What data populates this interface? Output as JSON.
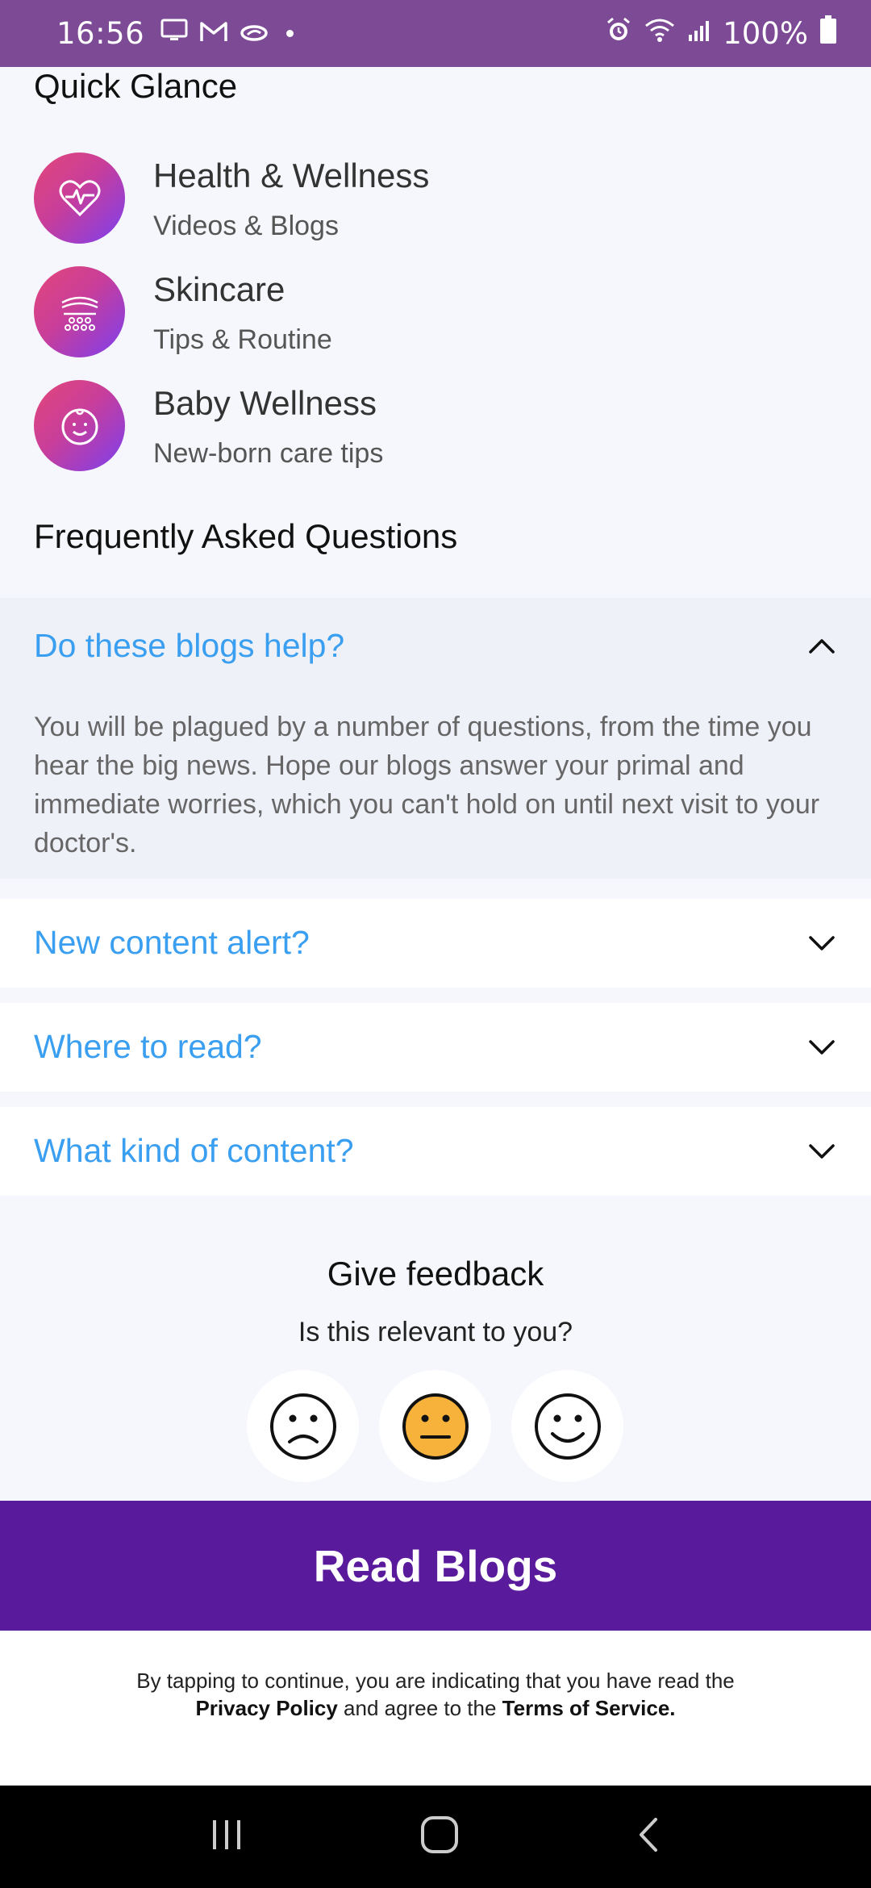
{
  "status_bar": {
    "time": "16:56",
    "battery": "100%",
    "icons_left": [
      "monitor-icon",
      "gmail-icon",
      "link-icon",
      "dot"
    ],
    "icons_right": [
      "alarm-icon",
      "wifi-icon",
      "signal-icon",
      "battery-icon"
    ]
  },
  "quick_glance": {
    "title": "Quick Glance",
    "items": [
      {
        "title": "Health & Wellness",
        "subtitle": "Videos & Blogs",
        "icon": "heart-pulse-icon"
      },
      {
        "title": "Skincare",
        "subtitle": "Tips & Routine",
        "icon": "skincare-icon"
      },
      {
        "title": "Baby Wellness",
        "subtitle": "New-born care tips",
        "icon": "baby-face-icon"
      }
    ]
  },
  "faq": {
    "title": "Frequently Asked Questions",
    "items": [
      {
        "question": "Do these blogs help?",
        "answer": "You will be plagued by a number of questions, from the time you hear the big news. Hope our blogs answer your primal and immediate worries, which you can't hold on until next visit to your doctor's.",
        "expanded": true
      },
      {
        "question": "New content alert?",
        "expanded": false
      },
      {
        "question": "Where to read?",
        "expanded": false
      },
      {
        "question": "What kind of content?",
        "expanded": false
      }
    ]
  },
  "feedback": {
    "title": "Give feedback",
    "subtitle": "Is this relevant to you?",
    "options": [
      {
        "name": "sad-face-icon",
        "selected": false
      },
      {
        "name": "neutral-face-icon",
        "selected": true
      },
      {
        "name": "happy-face-icon",
        "selected": false
      }
    ],
    "selected_color": "#f7b23b"
  },
  "cta": {
    "label": "Read Blogs",
    "color": "#5a1a9c"
  },
  "legal": {
    "prefix": "By tapping to continue, you are indicating that you have read the",
    "privacy": "Privacy Policy",
    "middle": "and agree to the",
    "terms": "Terms of Service."
  },
  "colors": {
    "accent_blue": "#3a9ff0",
    "status_bar": "#7d4a96"
  }
}
